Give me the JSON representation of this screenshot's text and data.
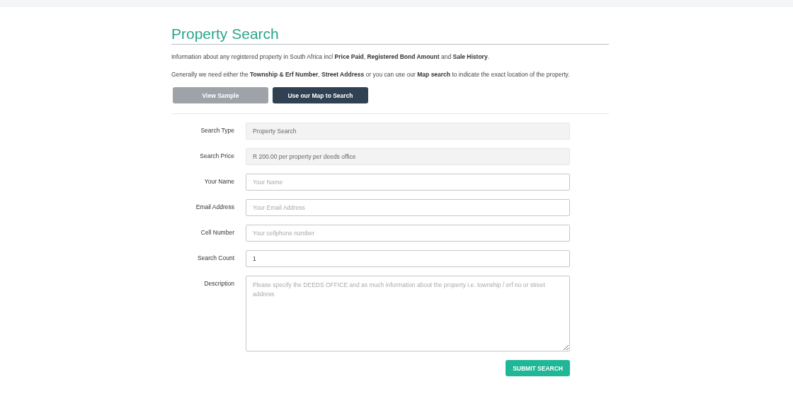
{
  "title": "Property Search",
  "intro": "Information about any registered property in South Africa incl **Price Paid**, **Registered Bond Amount** and **Sale History**.",
  "note": "Generally we need either the **Township & Erf Number**, **Street Address** or you can use our **Map search** to indicate the exact location of the property.",
  "buttons": [
    {
      "label": "View Sample",
      "disabled": true
    },
    {
      "label": "Use our Map to Search",
      "disabled": false
    }
  ],
  "fields": [
    {
      "label": "Search Type",
      "kind": "readonly",
      "value": "Property Search"
    },
    {
      "label": "Search Price",
      "kind": "readonly",
      "value": "R 200.00 per property per deeds office"
    },
    {
      "label": "Your Name",
      "kind": "input",
      "placeholder": "Your Name"
    },
    {
      "label": "Email Address",
      "kind": "input",
      "placeholder": "Your Email Address"
    },
    {
      "label": "Cell Number",
      "kind": "input",
      "placeholder": "Your cellphone number"
    },
    {
      "label": "Search Count",
      "kind": "input",
      "value": "1"
    },
    {
      "label": "Description",
      "kind": "textarea",
      "placeholder": "Please specify the DEEDS OFFICE and as much information about the property i.e. township / erf no or street address"
    }
  ],
  "submit": "SUBMIT SEARCH"
}
